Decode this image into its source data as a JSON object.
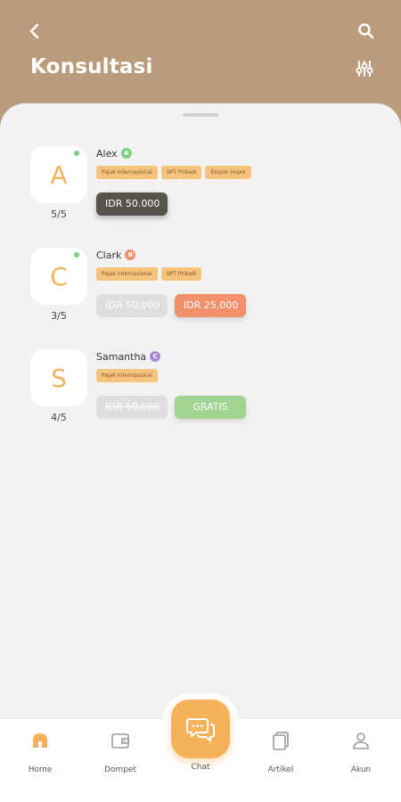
{
  "header": {
    "title": "Konsultasi"
  },
  "consultants": [
    {
      "initial": "A",
      "name": "Alex",
      "grade": "A",
      "grade_color": "#7fcf7f",
      "rating": "5/5",
      "online": true,
      "tags": [
        "Pajak Internasional",
        "SPT Pribadi",
        "Ekspor Impor"
      ],
      "price_primary": "IDR 50.000"
    },
    {
      "initial": "C",
      "name": "Clark",
      "grade": "B",
      "grade_color": "#f3906c",
      "rating": "3/5",
      "online": true,
      "tags": [
        "Pajak Internasional",
        "SPT Pribadi"
      ],
      "price_original": "IDR 50.000",
      "price_discount": "IDR 25.000"
    },
    {
      "initial": "S",
      "name": "Samantha",
      "grade": "C",
      "grade_color": "#a68ad8",
      "rating": "4/5",
      "online": false,
      "tags": [
        "Pajak Internasional"
      ],
      "price_original": "IDR 50.000",
      "price_discount": "GRATIS"
    }
  ],
  "nav": {
    "home": "Home",
    "wallet": "Dompet",
    "chat": "Chat",
    "articles": "Artikel",
    "account": "Akun"
  },
  "colors": {
    "header_bg": "#b89c7c",
    "accent": "#f6b25a",
    "surface": "#f2f2f2"
  }
}
